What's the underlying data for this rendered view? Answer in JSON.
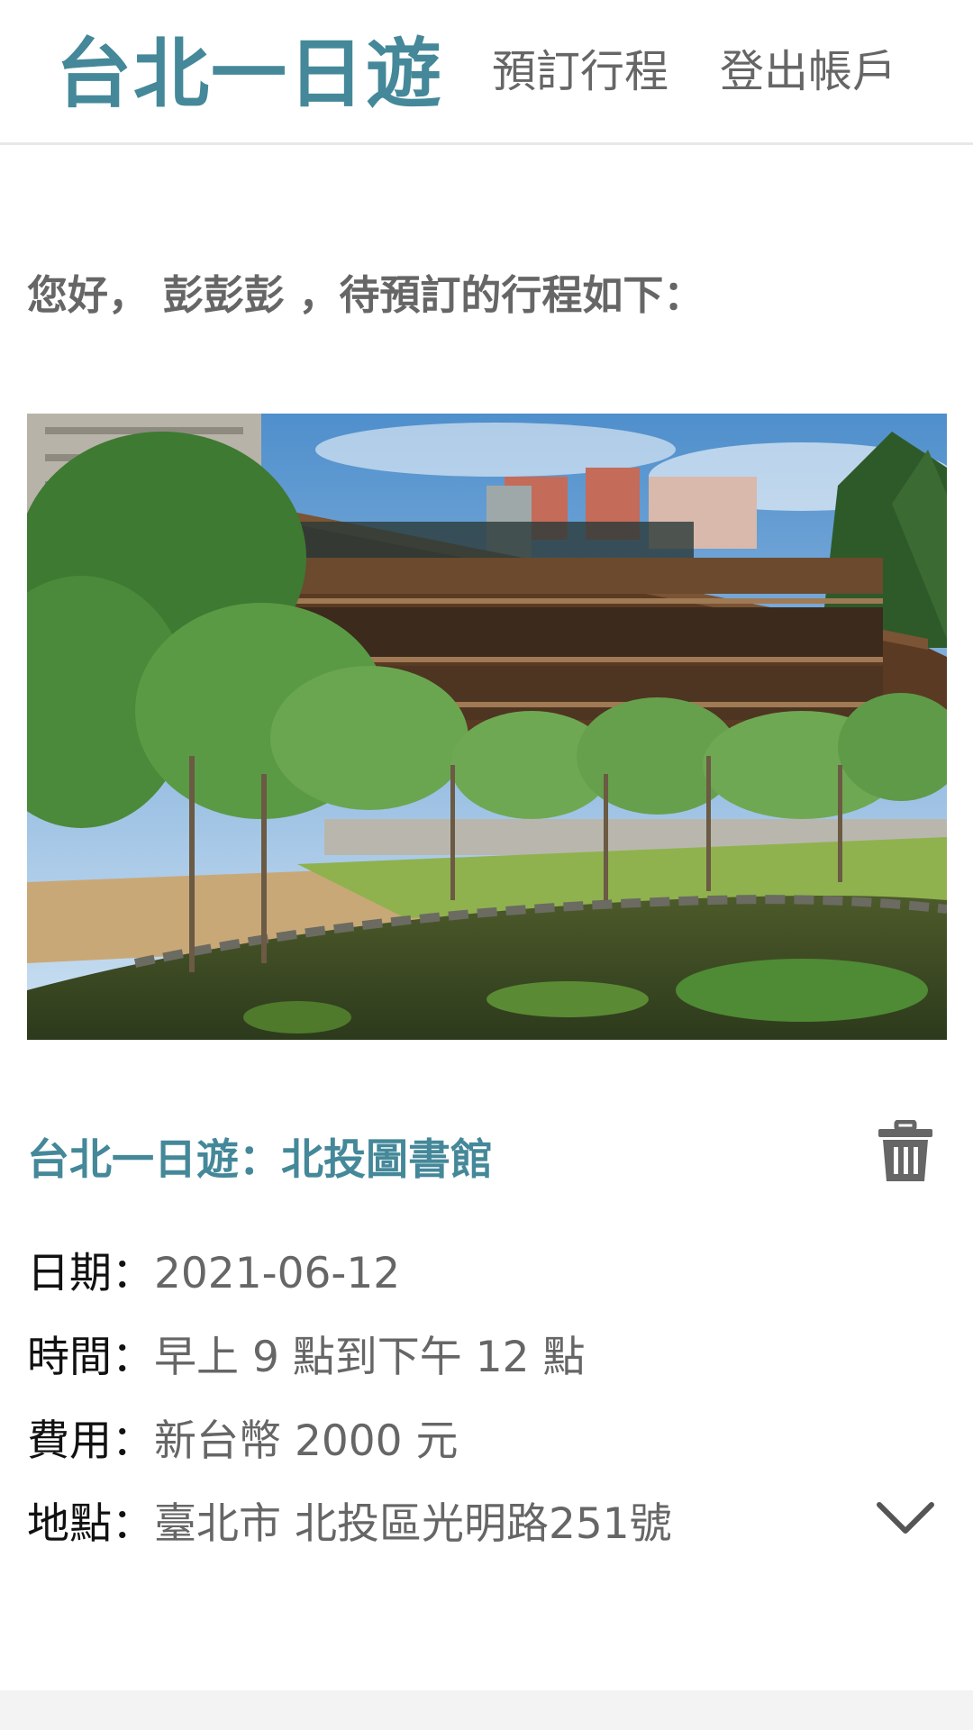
{
  "navbar": {
    "brand": "台北一日遊",
    "links": [
      "預訂行程",
      "登出帳戶"
    ]
  },
  "greeting": "您好， 彭彭彭 ，待預訂的行程如下：",
  "booking": {
    "title": "台北一日遊：北投圖書館",
    "rows": [
      {
        "label": "日期：",
        "value": "2021-06-12"
      },
      {
        "label": "時間：",
        "value": "早上 9 點到下午 12 點"
      },
      {
        "label": "費用：",
        "value": "新台幣 2000 元"
      },
      {
        "label": "地點：",
        "value": "臺北市 北投區光明路251號"
      }
    ]
  },
  "icons": {
    "delete": "trash-icon",
    "expand": "chevron-down-icon"
  },
  "colors": {
    "accent": "#448899",
    "text": "#666666",
    "label": "#111111"
  }
}
